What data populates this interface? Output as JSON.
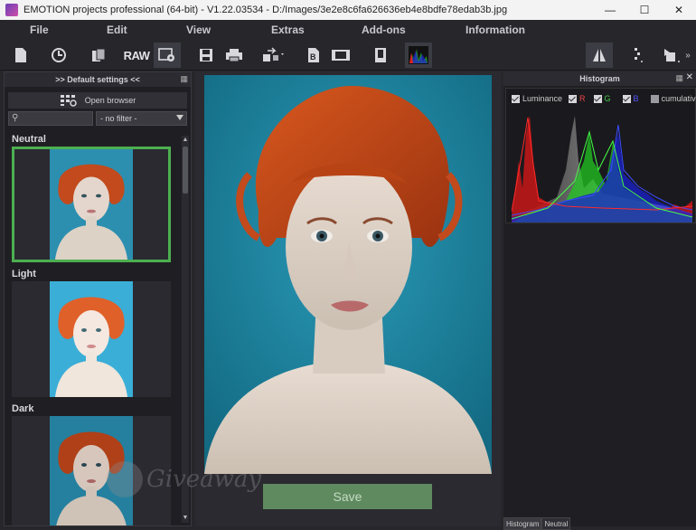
{
  "window": {
    "title": "EMOTION projects professional (64-bit) - V1.22.03534 - D:/Images/3e2e8c6fa626636eb4e8bdfe78edab3b.jpg",
    "controls": [
      "minimize-icon",
      "maximize-icon",
      "close-icon"
    ]
  },
  "menu": {
    "items": [
      "File",
      "Edit",
      "View",
      "Extras",
      "Add-ons",
      "Information"
    ]
  },
  "toolbar": {
    "raw_label": "RAW",
    "tools": [
      "new-document-icon",
      "history-icon",
      "copy-icon",
      "raw-icon",
      "settings-image-icon",
      "save-icon",
      "print-icon",
      "export-icon",
      "batch-icon",
      "film-icon",
      "book-icon",
      "histogram-icon",
      "compare-icon",
      "split-icon",
      "export-side-icon"
    ],
    "active": [
      "settings-image-icon",
      "histogram-icon",
      "compare-icon"
    ]
  },
  "left_panel": {
    "title": ">> Default settings <<",
    "open_browser": "Open browser",
    "search": {
      "value": ""
    },
    "filter": {
      "selected": "- no filter -"
    },
    "presets": [
      {
        "label": "Neutral",
        "selected": true
      },
      {
        "label": "Light",
        "selected": false
      },
      {
        "label": "Dark",
        "selected": false
      }
    ]
  },
  "center": {
    "save_label": "Save"
  },
  "histogram": {
    "title": "Histogram",
    "checks": [
      {
        "label": "Luminance",
        "on": true
      },
      {
        "label": "R",
        "on": true
      },
      {
        "label": "G",
        "on": true
      },
      {
        "label": "B",
        "on": true
      },
      {
        "label": "cumulative",
        "on": false
      }
    ],
    "colors": {
      "red": "#e02020",
      "green": "#30d030",
      "blue": "#2030e0",
      "luminance": "#bbbbbb"
    }
  },
  "bottom_tabs": [
    "Histogram",
    "Neutral"
  ],
  "watermark": {
    "text": "Giveaway"
  }
}
